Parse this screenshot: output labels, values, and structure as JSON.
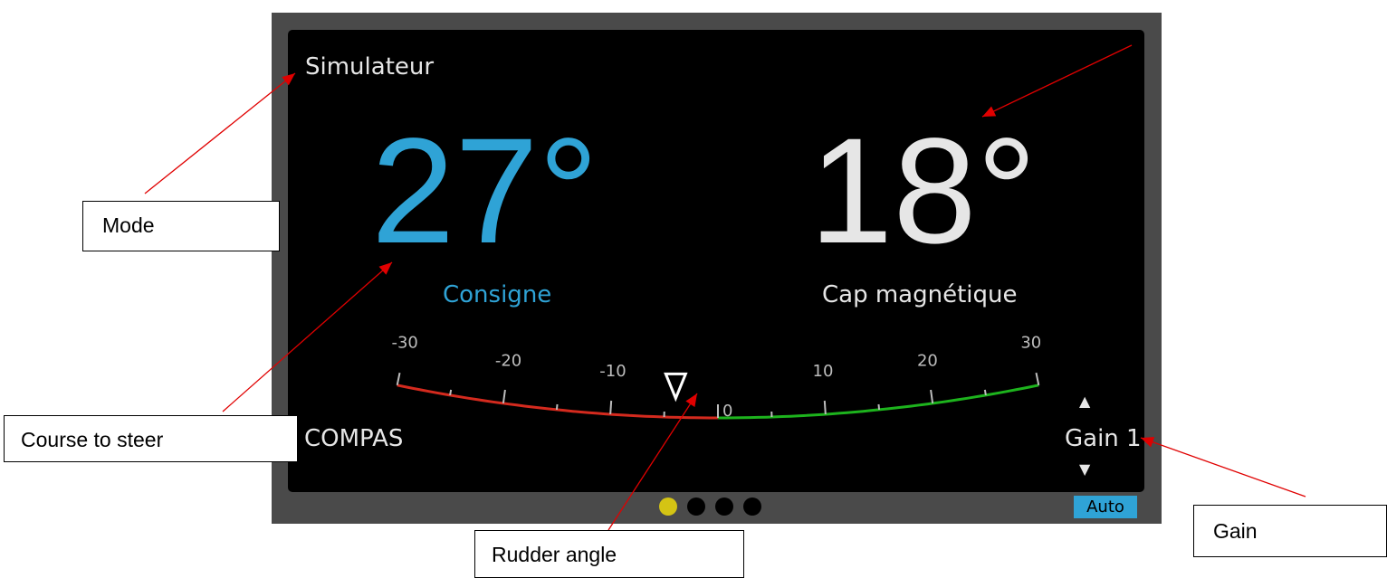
{
  "display": {
    "mode": "Simulateur",
    "target": {
      "value": "27°",
      "label": "Consigne"
    },
    "heading": {
      "value": "18°",
      "label": "Cap magnétique"
    },
    "sensor": "COMPAS",
    "gain": {
      "label": "Gain 1",
      "up_icon": "▲",
      "down_icon": "▼"
    },
    "rudder": {
      "tick_labels": [
        "-30",
        "-20",
        "-10",
        "0",
        "10",
        "20",
        "30"
      ],
      "tick_values": [
        -30,
        -20,
        -10,
        0,
        10,
        20,
        30
      ],
      "minor_values": [
        -30,
        -25,
        -20,
        -15,
        -10,
        -5,
        0,
        5,
        10,
        15,
        20,
        25,
        30
      ],
      "angle": -4,
      "port_color": "#d42a1e",
      "starboard_color": "#1db31d",
      "pointer_icon": "triangle-down-icon"
    },
    "pages": {
      "count": 4,
      "active": 1
    },
    "auto_badge": "Auto",
    "colors": {
      "accent": "#2fa3d6",
      "text": "#e6e6e6",
      "bezel": "#4a4a4a",
      "active_dot": "#d4c414"
    }
  },
  "annotations": {
    "mode": "Mode",
    "course": "Course to steer",
    "rudder": "Rudder angle",
    "gain": "Gain",
    "arrow_color": "#e00000"
  }
}
